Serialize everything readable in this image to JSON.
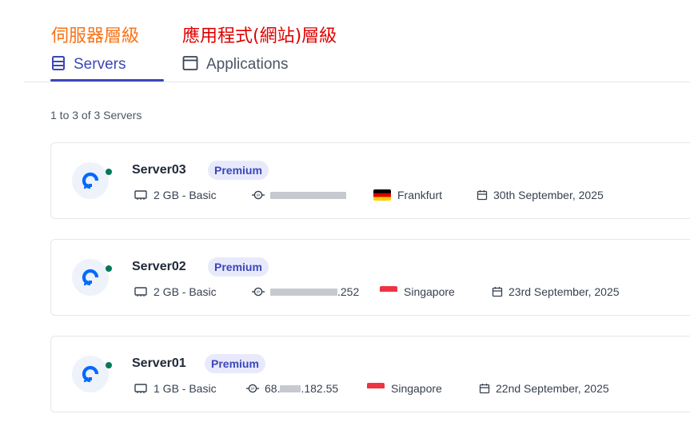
{
  "annotations": {
    "server_level": "伺服器層級",
    "app_level": "應用程式(網站)層級"
  },
  "tabs": [
    {
      "label": "Servers",
      "active": true,
      "icon": "server-icon"
    },
    {
      "label": "Applications",
      "active": false,
      "icon": "window-icon"
    }
  ],
  "server_count_text": "1 to 3 of 3 Servers",
  "colors": {
    "accent": "#3b47b8",
    "badge_bg": "#e8eafc",
    "status_online": "#047857",
    "annotation_orange": "#f97316",
    "annotation_red": "#e00000"
  },
  "servers": [
    {
      "name": "Server03",
      "badge": "Premium",
      "size": "2 GB - Basic",
      "ip_suffix": "",
      "location": "Frankfurt",
      "flag": "germany",
      "date": "30th September, 2025"
    },
    {
      "name": "Server02",
      "badge": "Premium",
      "size": "2 GB - Basic",
      "ip_suffix": ".252",
      "location": "Singapore",
      "flag": "singapore",
      "date": "23rd September, 2025"
    },
    {
      "name": "Server01",
      "badge": "Premium",
      "size": "1 GB - Basic",
      "ip_prefix": "68.",
      "ip_suffix": ".182.55",
      "location": "Singapore",
      "flag": "singapore",
      "date": "22nd September, 2025"
    }
  ]
}
